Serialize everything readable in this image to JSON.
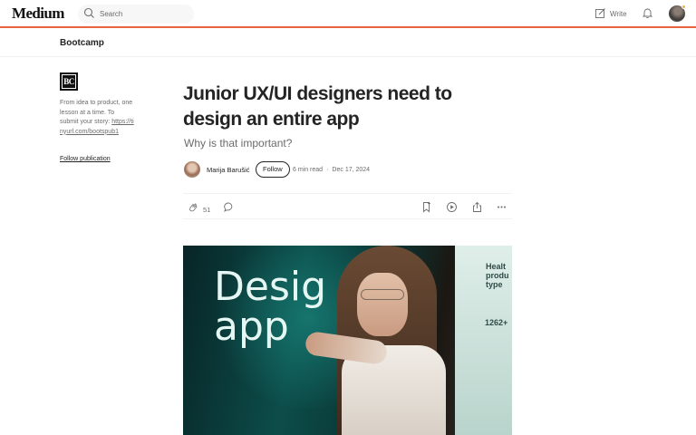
{
  "topbar": {
    "logo": "Medium",
    "search_placeholder": "Search",
    "write_label": "Write"
  },
  "publication": {
    "name": "Bootcamp",
    "logo_text": "BC",
    "description": "From idea to product, one lesson at a time. To submit your story: ",
    "link_text": "https://tinyurl.com/bootspub1",
    "follow_label": "Follow publication"
  },
  "article": {
    "title": "Junior UX/UI designers need to design an entire app",
    "subtitle": "Why is that important?",
    "author": "Marija Barušić",
    "follow_label": "Follow",
    "read_time": "6 min read",
    "date": "Dec 17, 2024",
    "claps": "51"
  },
  "hero_image": {
    "big_text_line1": "Desig",
    "big_text_line2": "app",
    "screen_text": "Healt produ type",
    "screen_number": "1262+"
  },
  "colors": {
    "accent": "#e8643c",
    "text": "#242424",
    "muted": "#6b6b6b"
  },
  "icons": [
    "search-icon",
    "write-icon",
    "bell-icon",
    "clap-icon",
    "comment-icon",
    "bookmark-icon",
    "play-icon",
    "share-icon",
    "more-icon"
  ]
}
